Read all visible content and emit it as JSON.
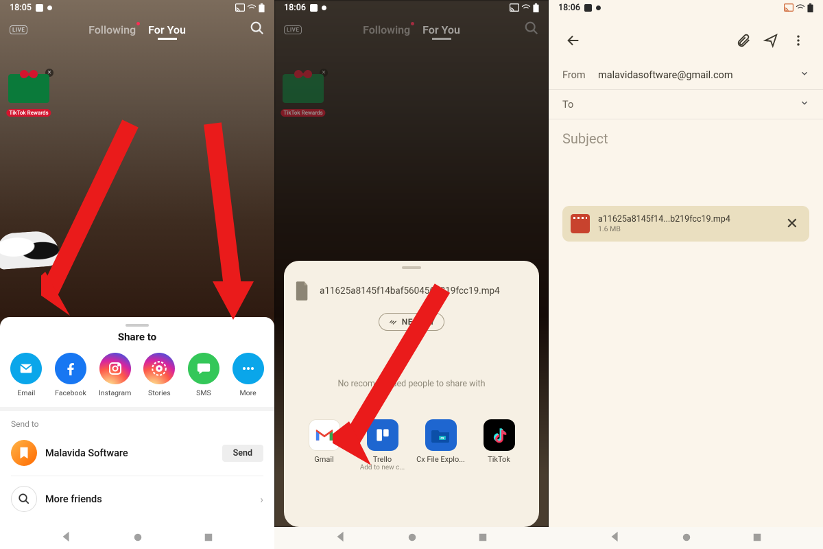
{
  "screens": [
    {
      "status": {
        "time": "18:05"
      },
      "tiktok_header": {
        "live": "LIVE",
        "following": "Following",
        "foryou": "For You"
      },
      "rewards": {
        "label": "TikTok Rewards"
      },
      "share_sheet": {
        "title": "Share to",
        "items": [
          {
            "label": "Email"
          },
          {
            "label": "Facebook"
          },
          {
            "label": "Instagram"
          },
          {
            "label": "Stories"
          },
          {
            "label": "SMS"
          },
          {
            "label": "More"
          }
        ],
        "send_to_label": "Send to",
        "contact_name": "Malavida Software",
        "send_button": "Send",
        "more_friends": "More friends"
      }
    },
    {
      "status": {
        "time": "18:06"
      },
      "tiktok_header": {
        "live": "LIVE",
        "following": "Following",
        "foryou": "For You"
      },
      "rewards": {
        "label": "TikTok Rewards"
      },
      "android_share": {
        "file_name": "a11625a8145f14baf560456b219fcc19.mp4",
        "nearby": "NEARBY",
        "recommend": "No recommended people to share with",
        "apps": [
          {
            "label": "Gmail",
            "sub": ""
          },
          {
            "label": "Trello",
            "sub": "Add to new c..."
          },
          {
            "label": "Cx File Explo...",
            "sub": ""
          },
          {
            "label": "TikTok",
            "sub": ""
          }
        ]
      }
    },
    {
      "status": {
        "time": "18:06"
      },
      "compose": {
        "from_label": "From",
        "from_value": "malavidasoftware@gmail.com",
        "to_label": "To",
        "subject_placeholder": "Subject"
      },
      "attachment": {
        "name": "a11625a8145f14...b219fcc19.mp4",
        "size": "1.6 MB"
      }
    }
  ]
}
